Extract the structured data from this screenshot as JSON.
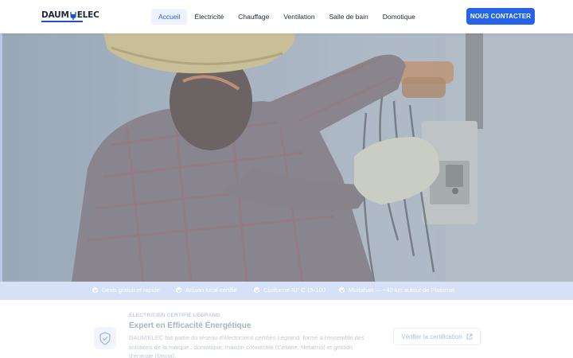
{
  "header": {
    "logo_left": "DAUM",
    "logo_right": "ELEC",
    "nav": [
      {
        "label": "Accueil",
        "active": true
      },
      {
        "label": "Électricité",
        "active": false
      },
      {
        "label": "Chauffage",
        "active": false
      },
      {
        "label": "Ventilation",
        "active": false
      },
      {
        "label": "Salle de bain",
        "active": false
      },
      {
        "label": "Domotique",
        "active": false
      }
    ],
    "cta_label": "NOUS CONTACTER"
  },
  "hero": {
    "image": "electrician-working-on-panel"
  },
  "trust_bar": [
    {
      "label": "Devis gratuit et rapide"
    },
    {
      "label": "Artisan local certifié"
    },
    {
      "label": "Conforme NF C 15-100"
    },
    {
      "label": "Morbihan — ~40 km autour de Ploërmel"
    }
  ],
  "certification": {
    "kicker": "ÉLECTRICIEN CERTIFIÉ LEGRAND",
    "title": "Expert en Efficacité Énergétique",
    "text": "DAUM'ELEC fait partie du réseau d'électriciens certifiés Legrand, formé à l'ensemble des solutions de la marque : domotique, maison connectée (Céliane, Netatmo) et gestion d'énergie (Drivia).",
    "link_label": "Vérifier la certification",
    "icon": "shield-check-icon"
  },
  "colors": {
    "accent": "#2563eb",
    "trust_bar_bg": "#d6e0f6"
  }
}
